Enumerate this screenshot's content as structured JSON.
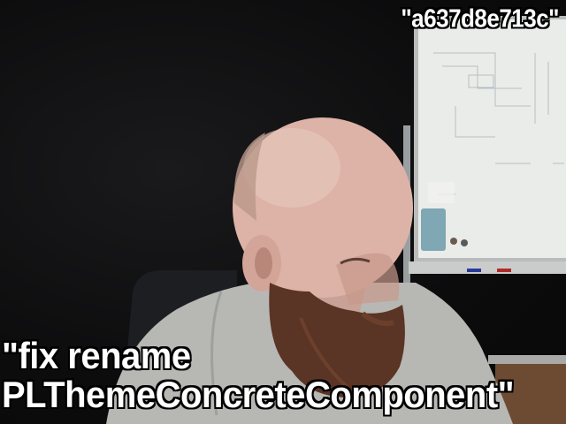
{
  "overlay": {
    "id_tag": "\"a637d8e713c\"",
    "message_line1": "\"fix rename",
    "message_line2": "PLThemeConcreteComponent\""
  },
  "scene": {
    "subject": "bald-bearded-man-icon",
    "background": "whiteboard-icon",
    "colors": {
      "wall": "#0c0c0d",
      "whiteboard": "#e9ece8",
      "skin": "#dcb3a6",
      "beard": "#5a3424",
      "sweater": "#b7b8b4"
    }
  }
}
